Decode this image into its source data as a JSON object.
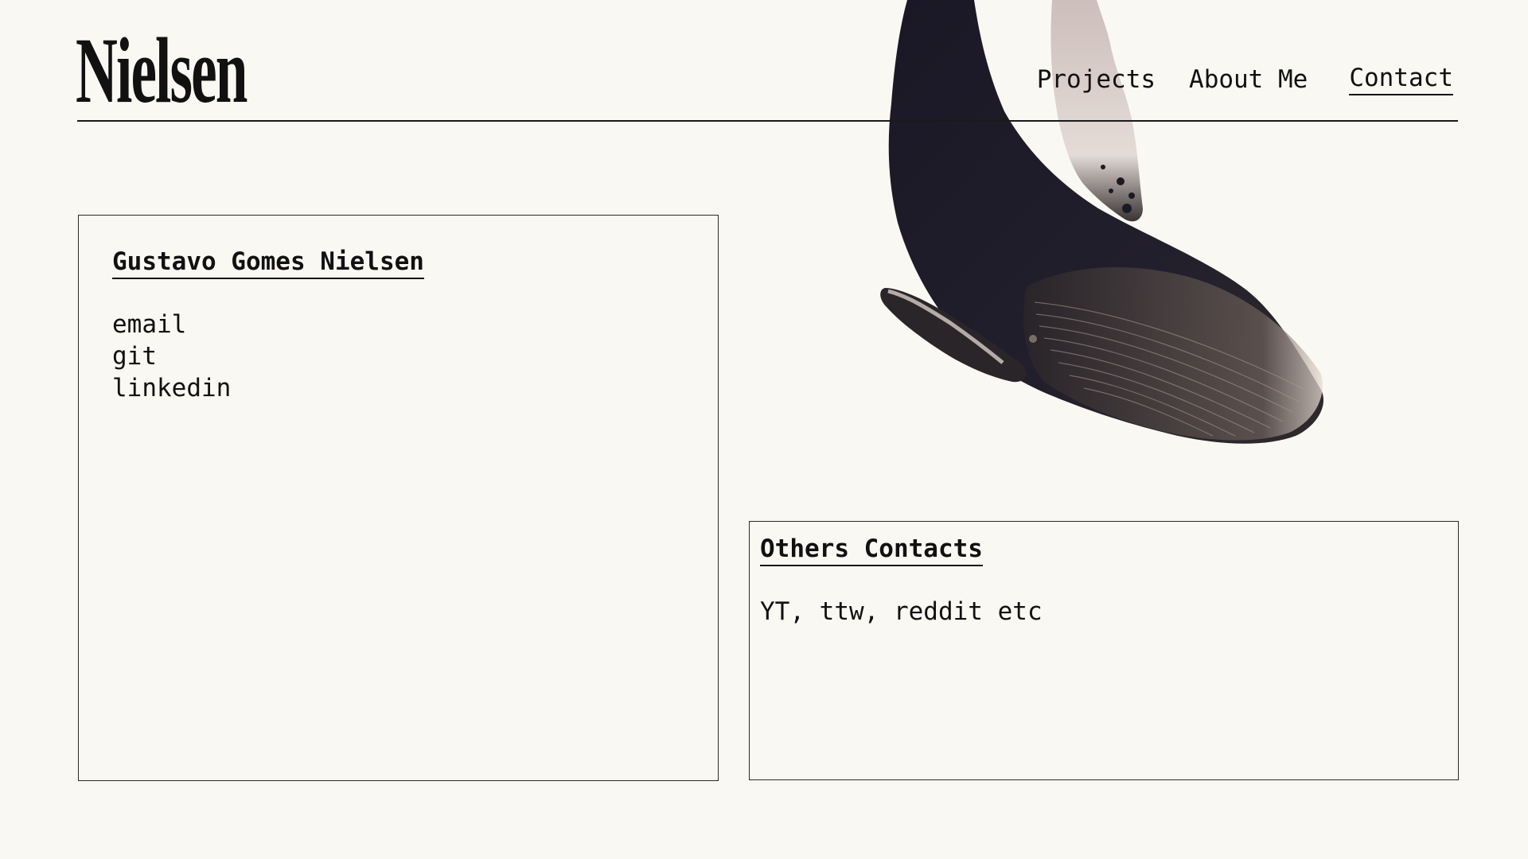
{
  "site": {
    "logo": "Nielsen"
  },
  "nav": {
    "items": [
      {
        "label": "Projects",
        "active": false
      },
      {
        "label": "About Me",
        "active": false
      },
      {
        "label": "Contact",
        "active": true
      }
    ]
  },
  "profile_card": {
    "name": "Gustavo Gomes Nielsen",
    "links": [
      {
        "label": "email"
      },
      {
        "label": "git"
      },
      {
        "label": "linkedin"
      }
    ]
  },
  "others_card": {
    "title": "Others Contacts",
    "text": "YT, ttw, reddit etc"
  },
  "colors": {
    "background": "#faf8f2",
    "text": "#111111",
    "border": "#2a2a2a",
    "whale_body": "#1d1b2a",
    "whale_fin": "#d9cfcb"
  },
  "icons": {
    "hero_illustration": "humpback-whale-illustration"
  }
}
